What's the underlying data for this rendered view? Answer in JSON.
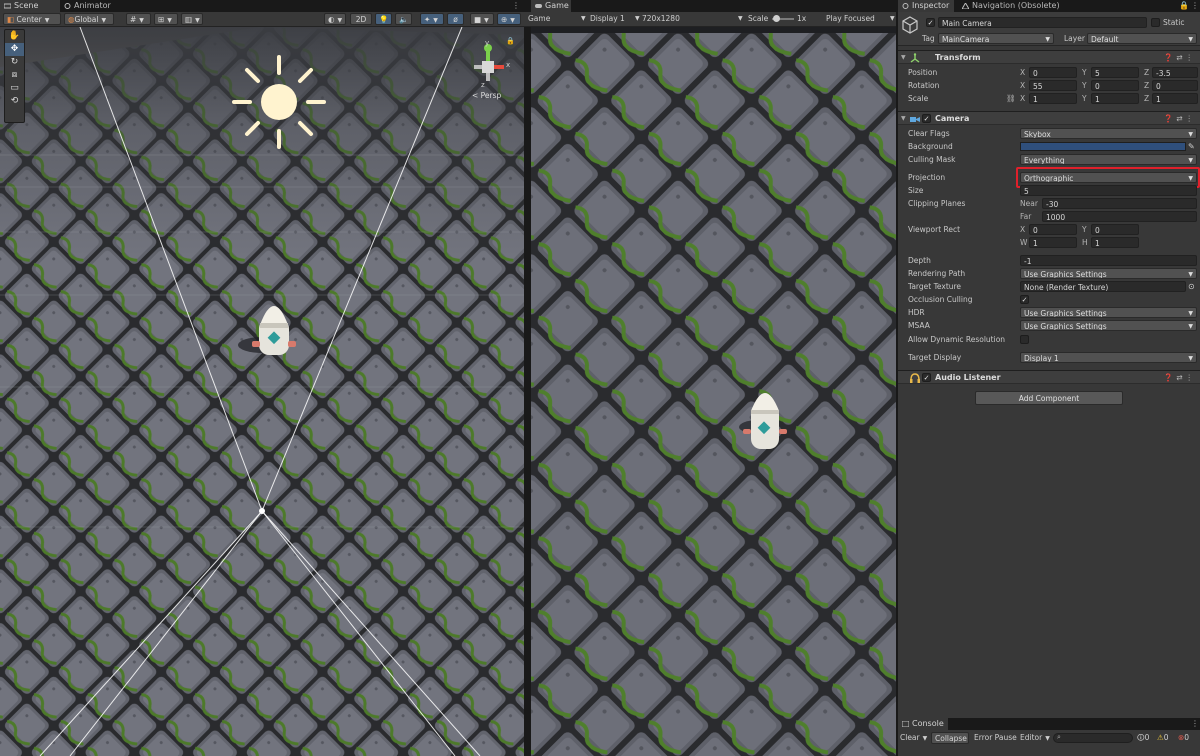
{
  "scene_tabs": {
    "scene": "Scene",
    "animator": "Animator"
  },
  "scene_toolbar": {
    "pivot": "Center",
    "space": "Global",
    "mode_2d": "2D",
    "persp": "< Persp"
  },
  "gizmo": {
    "y": "y",
    "x": "x",
    "z": "z"
  },
  "game_tab": {
    "label": "Game"
  },
  "game_toolbar": {
    "game": "Game",
    "display": "Display 1",
    "resolution": "720x1280",
    "scale_label": "Scale",
    "scale_value": "1x",
    "play_mode": "Play Focused"
  },
  "inspector": {
    "tab": "Inspector",
    "nav_tab": "Navigation (Obsolete)",
    "object_name": "Main Camera",
    "static_label": "Static",
    "tag_label": "Tag",
    "tag_value": "MainCamera",
    "layer_label": "Layer",
    "layer_value": "Default",
    "transform": {
      "title": "Transform",
      "position_label": "Position",
      "rotation_label": "Rotation",
      "scale_label": "Scale",
      "position": {
        "x": "0",
        "y": "5",
        "z": "-3.5"
      },
      "rotation": {
        "x": "55",
        "y": "0",
        "z": "0"
      },
      "scale": {
        "x": "1",
        "y": "1",
        "z": "1"
      }
    },
    "camera": {
      "title": "Camera",
      "clear_flags_label": "Clear Flags",
      "clear_flags": "Skybox",
      "background_label": "Background",
      "background_color": "#2f4f7c",
      "culling_mask_label": "Culling Mask",
      "culling_mask": "Everything",
      "projection_label": "Projection",
      "projection": "Orthographic",
      "size_label": "Size",
      "size": "5",
      "clipping_label": "Clipping Planes",
      "near_label": "Near",
      "near": "-30",
      "far_label": "Far",
      "far": "1000",
      "viewport_label": "Viewport Rect",
      "vp": {
        "x": "0",
        "y": "0",
        "w": "1",
        "h": "1"
      },
      "depth_label": "Depth",
      "depth": "-1",
      "rendering_path_label": "Rendering Path",
      "rendering_path": "Use Graphics Settings",
      "target_texture_label": "Target Texture",
      "target_texture": "None (Render Texture)",
      "occlusion_label": "Occlusion Culling",
      "hdr_label": "HDR",
      "hdr": "Use Graphics Settings",
      "msaa_label": "MSAA",
      "msaa": "Use Graphics Settings",
      "dyn_res_label": "Allow Dynamic Resolution",
      "target_display_label": "Target Display",
      "target_display": "Display 1"
    },
    "audio_listener": {
      "title": "Audio Listener"
    },
    "add_component": "Add Component"
  },
  "console": {
    "tab": "Console",
    "clear": "Clear",
    "collapse": "Collapse",
    "error_pause": "Error Pause",
    "editor": "Editor",
    "count_log": "0",
    "count_warn": "0",
    "count_err": "0"
  },
  "colors": {
    "highlight": "#e0202b",
    "accent": "#4a7fbf",
    "panel": "#383838"
  }
}
